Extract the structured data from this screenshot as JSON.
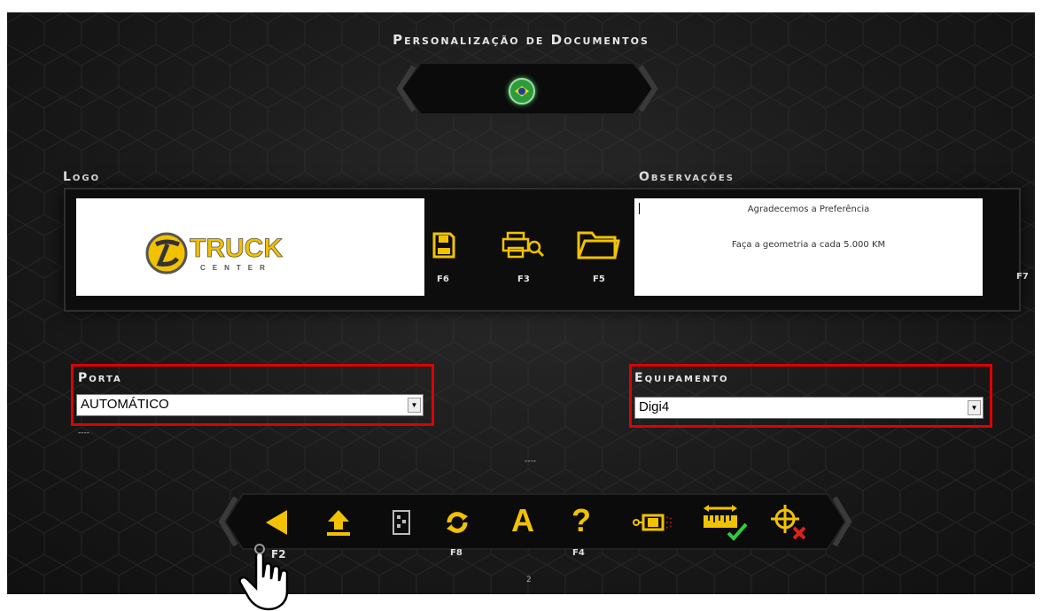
{
  "header": {
    "title": "Personalização de Documentos"
  },
  "language": {
    "flag": "brazil-flag-icon"
  },
  "logo_section": {
    "label": "Logo",
    "logo_text_main": "TRUCK",
    "logo_text_sub": "CENTER"
  },
  "file_actions": [
    {
      "icon": "save-icon",
      "key": "F6"
    },
    {
      "icon": "print-preview-icon",
      "key": "F3"
    },
    {
      "icon": "folder-open-icon",
      "key": "F5"
    }
  ],
  "observations": {
    "label": "Observações",
    "line1": "Agradecemos a Preferência",
    "line2": "Faça a geometria a cada 5.000 KM",
    "side_key": "F7"
  },
  "porta": {
    "label": "Porta",
    "value": "AUTOMÁTICO",
    "status": "----"
  },
  "equipamento": {
    "label": "Equipamento",
    "value": "Digi4"
  },
  "center_status": "----",
  "toolbar": {
    "keys": {
      "back": "F2",
      "refresh": "F8",
      "help": "F4"
    },
    "buttons": [
      "back-arrow-icon",
      "upload-icon",
      "document-icon",
      "refresh-icon",
      "font-icon",
      "help-icon",
      "sensor-icon",
      "measure-check-icon",
      "target-remove-icon"
    ]
  },
  "page_number": "2",
  "colors": {
    "accent": "#f2c200",
    "highlight": "#e00000",
    "background": "#1a1a1a"
  }
}
